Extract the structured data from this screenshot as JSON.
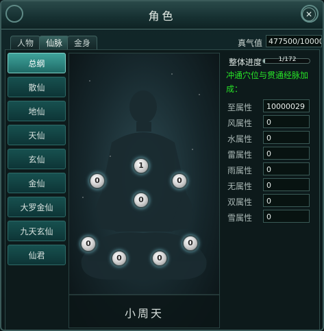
{
  "window": {
    "title": "角色",
    "close_glyph": "✕"
  },
  "tabs": [
    {
      "label": "人物",
      "active": false
    },
    {
      "label": "仙脉",
      "active": true
    },
    {
      "label": "金身",
      "active": false
    }
  ],
  "qi": {
    "label": "真气值",
    "value": "477500/10000"
  },
  "sidebar": {
    "items": [
      {
        "label": "总纲",
        "active": true
      },
      {
        "label": "散仙"
      },
      {
        "label": "地仙"
      },
      {
        "label": "天仙"
      },
      {
        "label": "玄仙"
      },
      {
        "label": "金仙"
      },
      {
        "label": "大罗金仙"
      },
      {
        "label": "九天玄仙"
      },
      {
        "label": "仙君"
      }
    ]
  },
  "meridian": {
    "caption": "小周天",
    "nodes": [
      "1",
      "0",
      "0",
      "0",
      "0",
      "0",
      "0",
      "0"
    ]
  },
  "progress": {
    "label": "整体进度",
    "text": "1/172",
    "fraction": 0.0058
  },
  "notice": "冲通穴位与贯通经脉加成：",
  "attributes": [
    {
      "label": "至属性",
      "value": "10000029"
    },
    {
      "label": "风属性",
      "value": "0"
    },
    {
      "label": "水属性",
      "value": "0"
    },
    {
      "label": "雷属性",
      "value": "0"
    },
    {
      "label": "雨属性",
      "value": "0"
    },
    {
      "label": "无属性",
      "value": "0"
    },
    {
      "label": "双属性",
      "value": "0"
    },
    {
      "label": "雪属性",
      "value": "0"
    }
  ],
  "colors": {
    "accent": "#3fa39b",
    "notice": "#27e227",
    "frame": "#3b5b5a"
  }
}
